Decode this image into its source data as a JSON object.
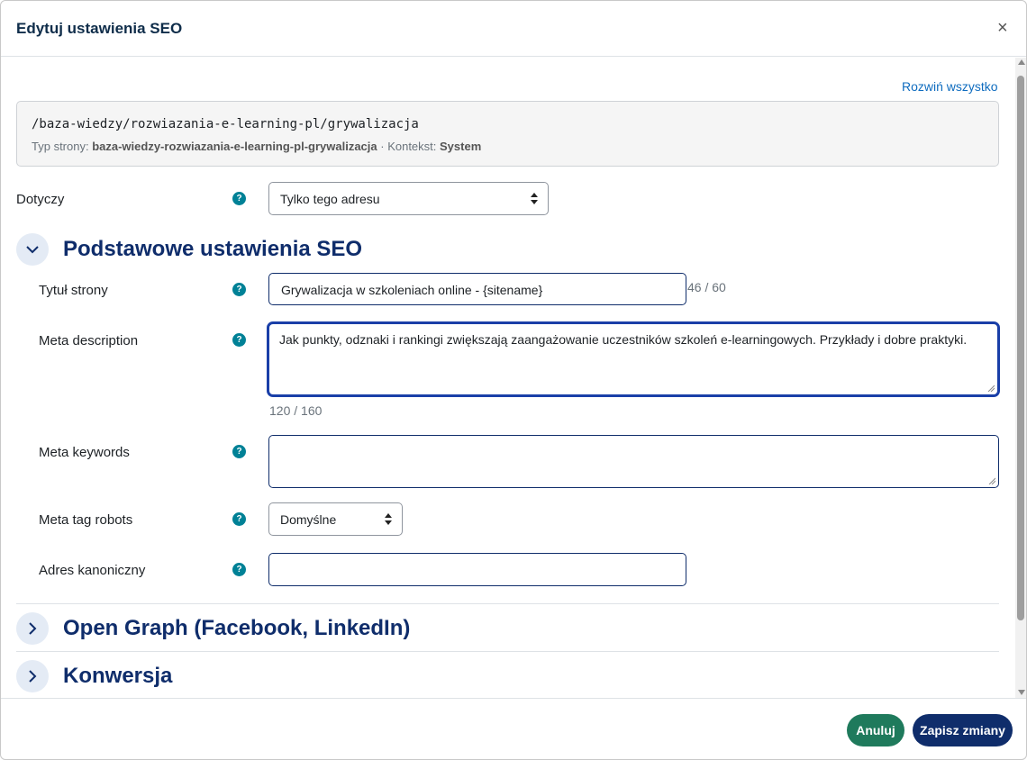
{
  "modal": {
    "title": "Edytuj ustawienia SEO",
    "close_symbol": "×"
  },
  "expand_all": "Rozwiń wszystko",
  "url_box": {
    "path": "/baza-wiedzy/rozwiazania-e-learning-pl/grywalizacja",
    "page_type_label": "Typ strony:",
    "page_type_value": "baza-wiedzy-rozwiazania-e-learning-pl-grywalizacja",
    "separator": " · ",
    "context_label": "Kontekst:",
    "context_value": "System"
  },
  "applies_to": {
    "label": "Dotyczy",
    "value": "Tylko tego adresu"
  },
  "sections": {
    "basic": {
      "title": "Podstawowe ustawienia SEO",
      "expanded": true
    },
    "open_graph": {
      "title": "Open Graph (Facebook, LinkedIn)",
      "expanded": false
    },
    "conversion": {
      "title": "Konwersja",
      "expanded": false
    }
  },
  "fields": {
    "page_title": {
      "label": "Tytuł strony",
      "value": "Grywalizacja w szkoleniach online - {sitename}",
      "counter": "46 / 60"
    },
    "meta_description": {
      "label": "Meta description",
      "value": "Jak punkty, odznaki i rankingi zwiększają zaangażowanie uczestników szkoleń e-learningowych. Przykłady i dobre praktyki.",
      "counter": "120 / 160"
    },
    "meta_keywords": {
      "label": "Meta keywords",
      "value": ""
    },
    "meta_robots": {
      "label": "Meta tag robots",
      "value": "Domyślne"
    },
    "canonical": {
      "label": "Adres kanoniczny",
      "value": ""
    }
  },
  "help_symbol": "?",
  "footer": {
    "cancel": "Anuluj",
    "save": "Zapisz zmiany"
  },
  "colors": {
    "primary": "#0f2d6b",
    "cancel_button": "#1f7a5c",
    "help_icon": "#008196",
    "link": "#0f6cbf"
  }
}
